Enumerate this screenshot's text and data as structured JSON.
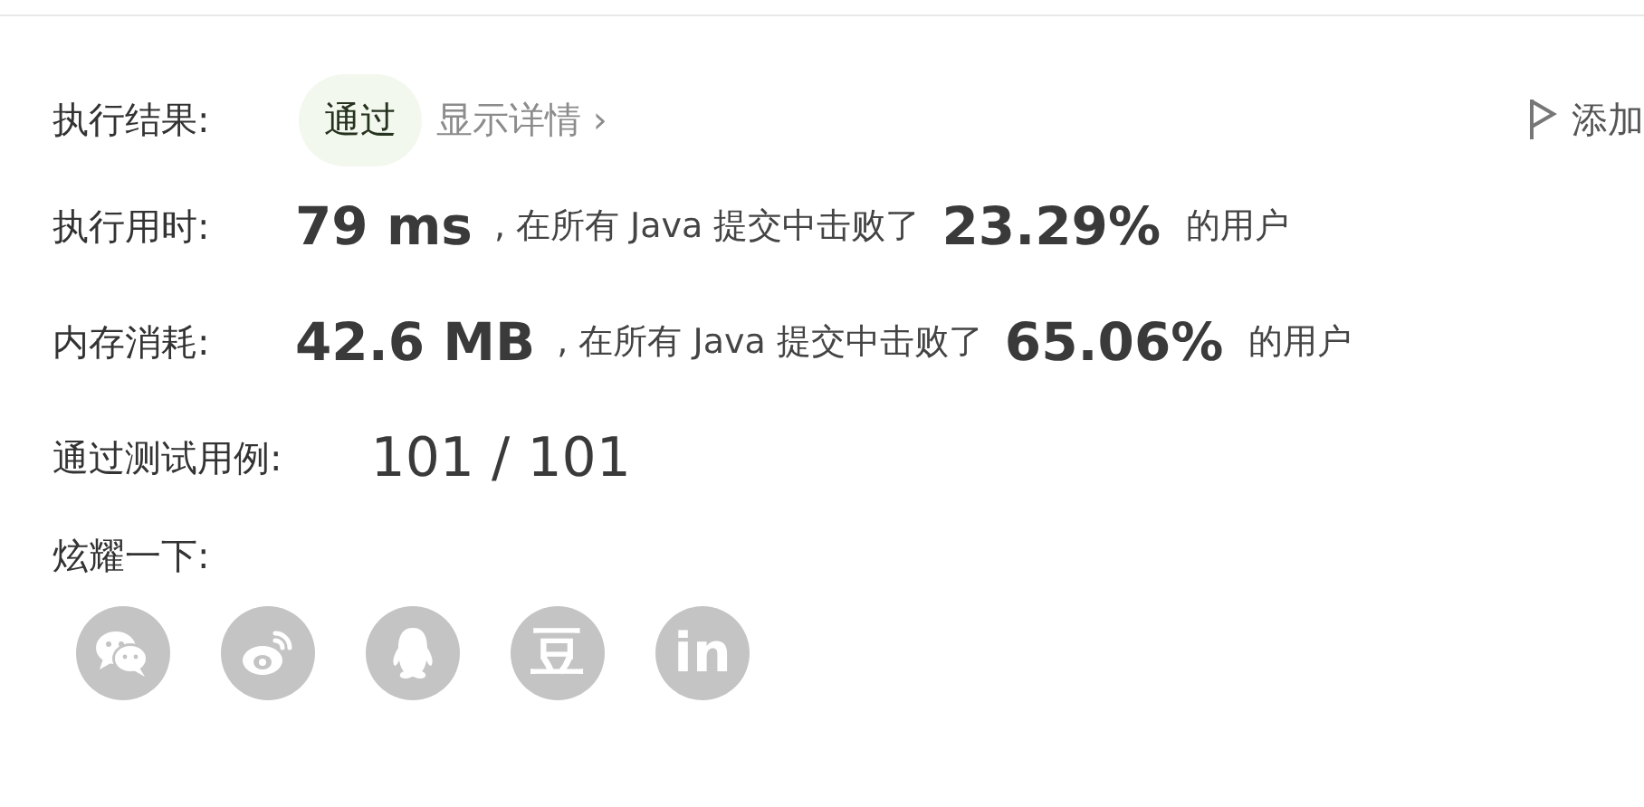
{
  "result": {
    "label": "执行结果:",
    "status": "通过",
    "passed": true,
    "details_link": "显示详情 ›",
    "note_button": "添加"
  },
  "stats": [
    {
      "label": "执行用时:",
      "value": "79 ms",
      "middle": ", 在所有 Java 提交中击败了",
      "percent": "23.29%",
      "suffix": "的用户"
    },
    {
      "label": "内存消耗:",
      "value": "42.6 MB",
      "middle": ", 在所有 Java 提交中击败了",
      "percent": "65.06%",
      "suffix": "的用户"
    }
  ],
  "tests": {
    "label": "通过测试用例:",
    "value": "101 / 101"
  },
  "share": {
    "label": "炫耀一下:",
    "items": [
      {
        "kind": "chat"
      },
      {
        "kind": "eye"
      },
      {
        "kind": "penguin"
      },
      {
        "kind": "glyph",
        "glyph": "豆"
      },
      {
        "kind": "glyph",
        "glyph": "in"
      }
    ]
  }
}
